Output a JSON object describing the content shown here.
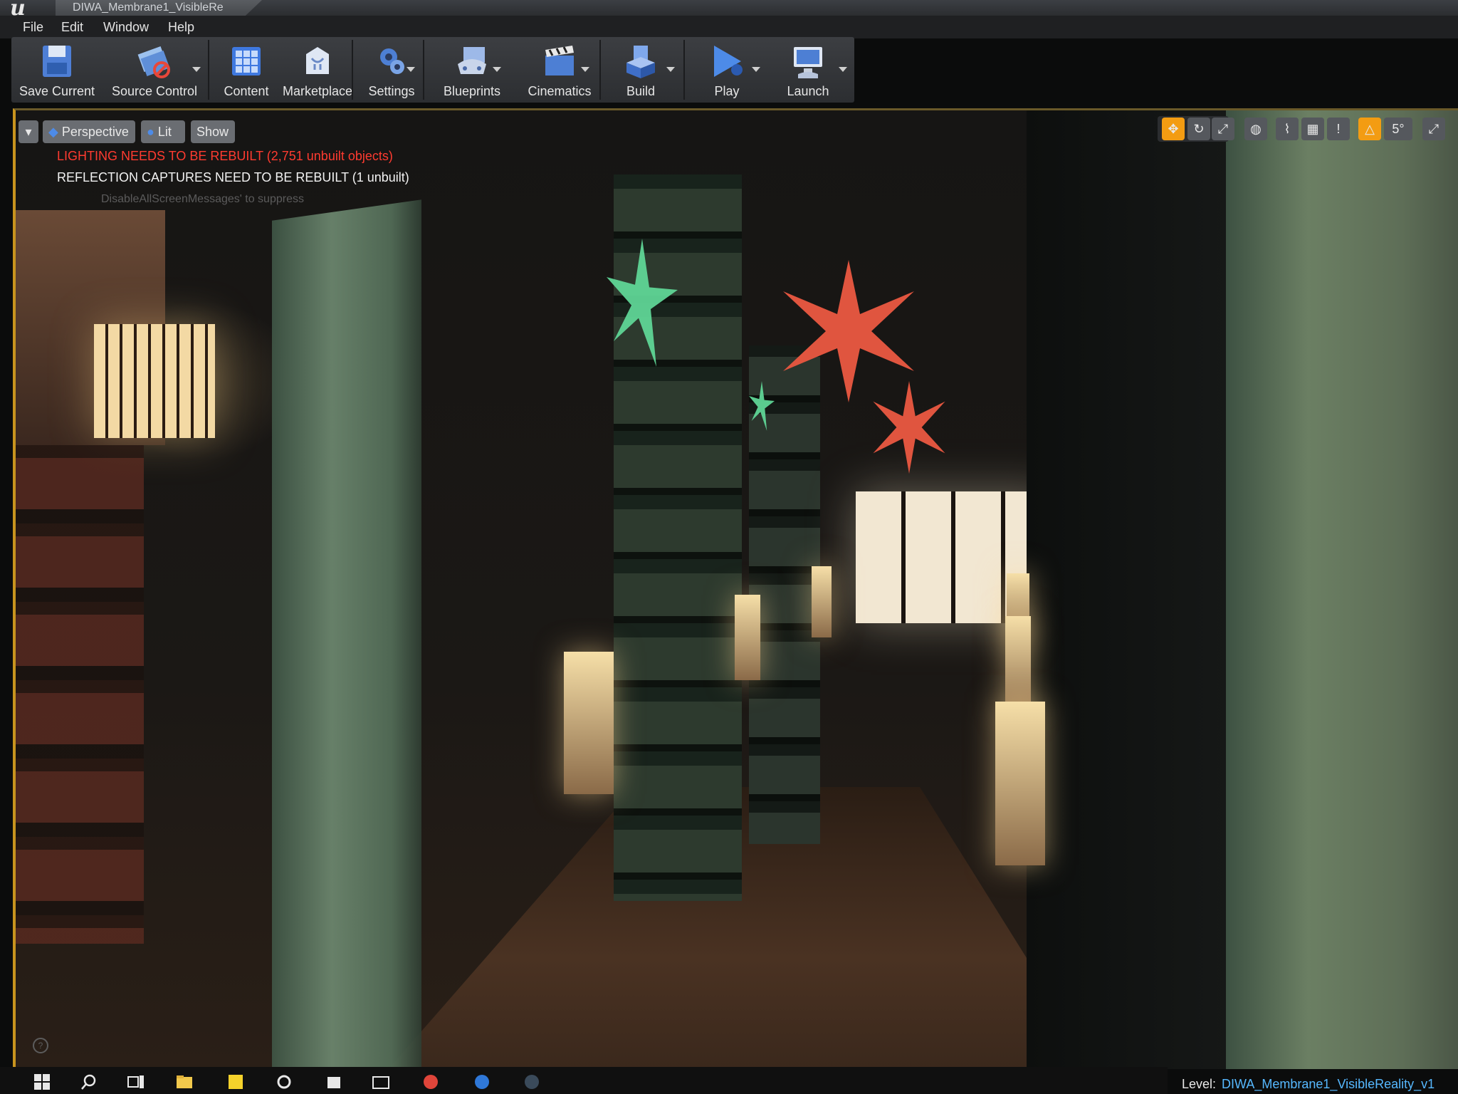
{
  "window": {
    "tab_title": "DIWA_Membrane1_VisibleRe"
  },
  "menu": [
    "File",
    "Edit",
    "Window",
    "Help"
  ],
  "toolbar": [
    {
      "label": "Save Current",
      "icon": "save-icon"
    },
    {
      "label": "Source Control",
      "icon": "source-control-icon"
    },
    {
      "label": "Content",
      "icon": "content-icon"
    },
    {
      "label": "Marketplace",
      "icon": "marketplace-icon"
    },
    {
      "label": "Settings",
      "icon": "settings-icon"
    },
    {
      "label": "Blueprints",
      "icon": "blueprints-icon"
    },
    {
      "label": "Cinematics",
      "icon": "cinematics-icon"
    },
    {
      "label": "Build",
      "icon": "build-icon"
    },
    {
      "label": "Play",
      "icon": "play-icon"
    },
    {
      "label": "Launch",
      "icon": "launch-icon"
    }
  ],
  "viewport": {
    "perspective_label": "Perspective",
    "lit_label": "Lit",
    "show_label": "Show",
    "warning_lighting": "LIGHTING NEEDS TO BE REBUILT (2,751 unbuilt objects)",
    "warning_reflection": "REFLECTION CAPTURES NEED TO BE REBUILT (1 unbuilt)",
    "suppress_hint": "DisableAllScreenMessages' to suppress",
    "rotation_snap": "5°",
    "accent_color": "#f39c12",
    "warning_color": "#ff3b30"
  },
  "status": {
    "level_key": "Level:",
    "level_value": "DIWA_Membrane1_VisibleReality_v1"
  }
}
